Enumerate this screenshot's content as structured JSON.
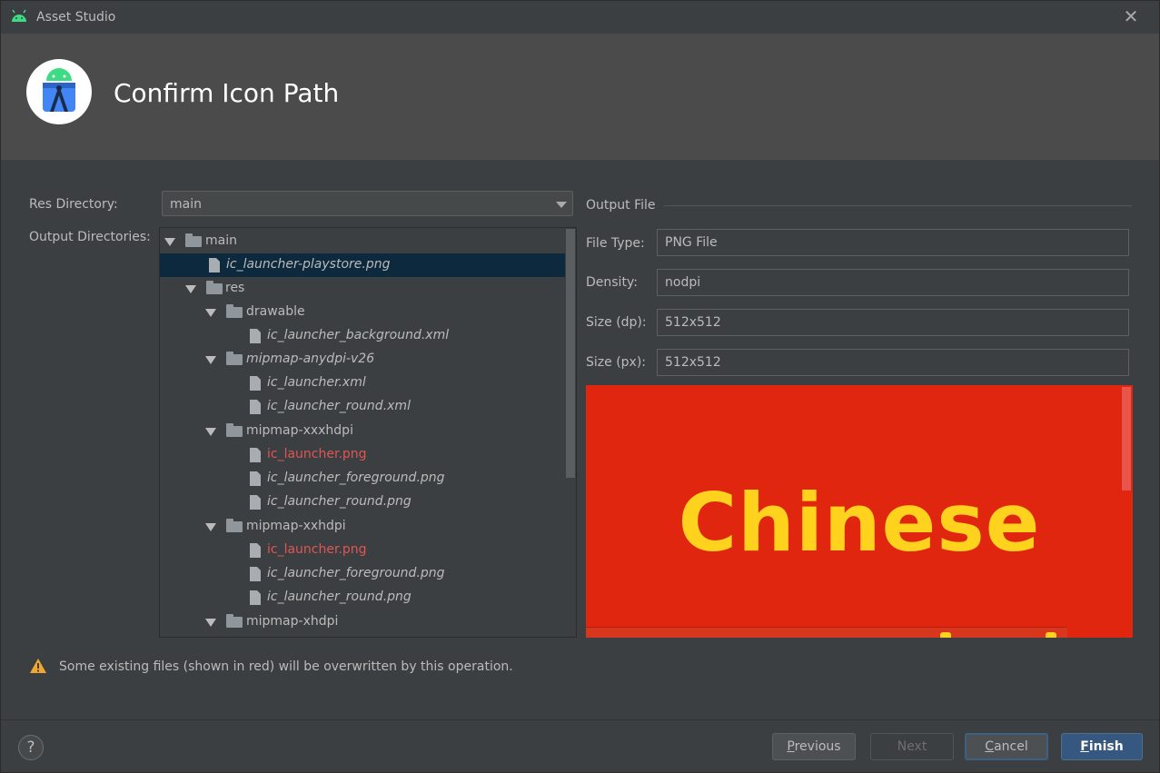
{
  "window": {
    "title": "Asset Studio",
    "close_glyph": "✕"
  },
  "header": {
    "heading": "Confirm Icon Path"
  },
  "res_directory": {
    "label": "Res Directory:",
    "value": "main"
  },
  "output_directories": {
    "label": "Output Directories:",
    "tree": [
      {
        "text": "main",
        "kind": "folder",
        "expanded": true,
        "italic": false,
        "red": false,
        "selected": false
      },
      {
        "text": "ic_launcher-playstore.png",
        "kind": "file",
        "italic": true,
        "red": false,
        "selected": true
      },
      {
        "text": "res",
        "kind": "folder",
        "expanded": true,
        "italic": false,
        "red": false,
        "selected": false
      },
      {
        "text": "drawable",
        "kind": "folder",
        "expanded": true,
        "italic": false,
        "red": false,
        "selected": false
      },
      {
        "text": "ic_launcher_background.xml",
        "kind": "file",
        "italic": true,
        "red": false,
        "selected": false
      },
      {
        "text": "mipmap-anydpi-v26",
        "kind": "folder",
        "expanded": true,
        "italic": true,
        "red": false,
        "selected": false
      },
      {
        "text": "ic_launcher.xml",
        "kind": "file",
        "italic": true,
        "red": false,
        "selected": false
      },
      {
        "text": "ic_launcher_round.xml",
        "kind": "file",
        "italic": true,
        "red": false,
        "selected": false
      },
      {
        "text": "mipmap-xxxhdpi",
        "kind": "folder",
        "expanded": true,
        "italic": false,
        "red": false,
        "selected": false
      },
      {
        "text": "ic_launcher.png",
        "kind": "file",
        "italic": false,
        "red": true,
        "selected": false
      },
      {
        "text": "ic_launcher_foreground.png",
        "kind": "file",
        "italic": true,
        "red": false,
        "selected": false
      },
      {
        "text": "ic_launcher_round.png",
        "kind": "file",
        "italic": true,
        "red": false,
        "selected": false
      },
      {
        "text": "mipmap-xxhdpi",
        "kind": "folder",
        "expanded": true,
        "italic": false,
        "red": false,
        "selected": false
      },
      {
        "text": "ic_launcher.png",
        "kind": "file",
        "italic": false,
        "red": true,
        "selected": false
      },
      {
        "text": "ic_launcher_foreground.png",
        "kind": "file",
        "italic": true,
        "red": false,
        "selected": false
      },
      {
        "text": "ic_launcher_round.png",
        "kind": "file",
        "italic": true,
        "red": false,
        "selected": false
      },
      {
        "text": "mipmap-xhdpi",
        "kind": "folder",
        "expanded": true,
        "italic": false,
        "red": false,
        "selected": false
      }
    ]
  },
  "output_file": {
    "section_title": "Output File",
    "file_type": {
      "label": "File Type:",
      "value": "PNG File"
    },
    "density": {
      "label": "Density:",
      "value": "nodpi"
    },
    "size_dp": {
      "label": "Size (dp):",
      "value": "512x512"
    },
    "size_px": {
      "label": "Size (px):",
      "value": "512x512"
    },
    "preview_text": "Chinese"
  },
  "warning": {
    "icon": "warning-icon",
    "text": "Some existing files (shown in red) will be overwritten by this operation."
  },
  "footer": {
    "help_glyph": "?",
    "previous": {
      "mnemonic": "P",
      "rest": "revious"
    },
    "next": "Next",
    "cancel": {
      "mnemonic": "C",
      "rest": "ancel"
    },
    "finish": {
      "mnemonic": "F",
      "rest": "inish"
    }
  },
  "colors": {
    "accent": "#365880",
    "warning": "#e05555",
    "preview_bg": "#e1260f",
    "preview_text": "#ffd21e"
  }
}
